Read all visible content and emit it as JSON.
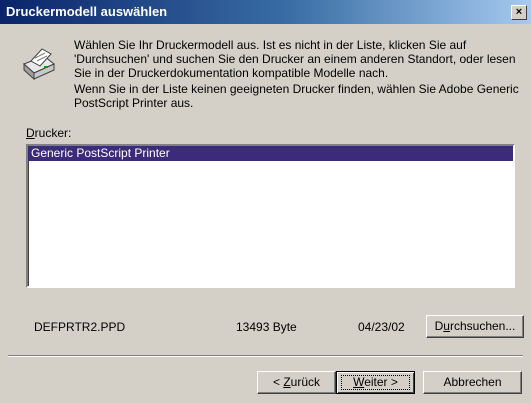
{
  "dialog": {
    "title": "Druckermodell auswählen",
    "close_glyph": "×"
  },
  "description": {
    "line1": "Wählen Sie Ihr Druckermodell aus. Ist es nicht in der Liste, klicken Sie auf 'Durchsuchen' und suchen Sie den Drucker an einem anderen Standort, oder lesen Sie in der Druckerdokumentation kompatible Modelle nach.",
    "line2": "Wenn Sie in der Liste keinen geeigneten Drucker finden, wählen Sie Adobe Generic PostScript Printer aus."
  },
  "printer_list": {
    "label_mnemonic": "D",
    "label_rest": "rucker:",
    "items": [
      {
        "label": "Generic PostScript Printer",
        "selected": true
      }
    ]
  },
  "file_info": {
    "name": "DEFPRTR2.PPD",
    "size": "13493 Byte",
    "date": "04/23/02"
  },
  "buttons": {
    "browse_pre": "D",
    "browse_mn": "u",
    "browse_post": "rchsuchen...",
    "back_pre": "< ",
    "back_mn": "Z",
    "back_post": "urück",
    "next_mn": "W",
    "next_post": "eiter >",
    "cancel": "Abbrechen"
  },
  "icons": {
    "printer": "printer-icon",
    "close": "close-icon"
  },
  "colors": {
    "titlebar_start": "#0a246a",
    "titlebar_end": "#a6caf0",
    "selection": "#3b2b7a",
    "window": "#d4d0c8"
  }
}
